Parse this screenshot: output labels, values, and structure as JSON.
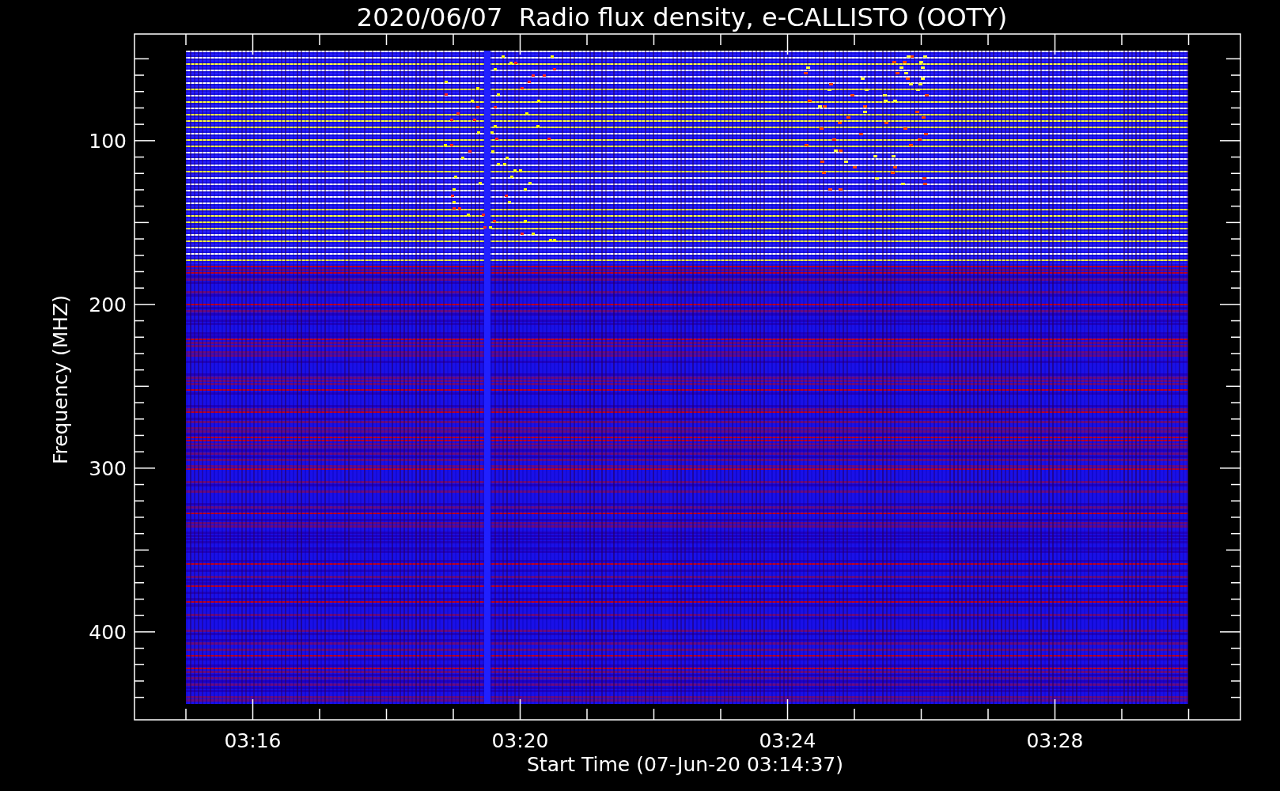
{
  "title": "2020/06/07  Radio flux density, e-CALLISTO (OOTY)",
  "ylabel": "Frequency (MHZ)",
  "xlabel": "Start Time (07-Jun-20 03:14:37)",
  "yticks": [
    "100",
    "200",
    "300",
    "400"
  ],
  "xticks": [
    "03:16",
    "03:20",
    "03:24",
    "03:28"
  ]
}
